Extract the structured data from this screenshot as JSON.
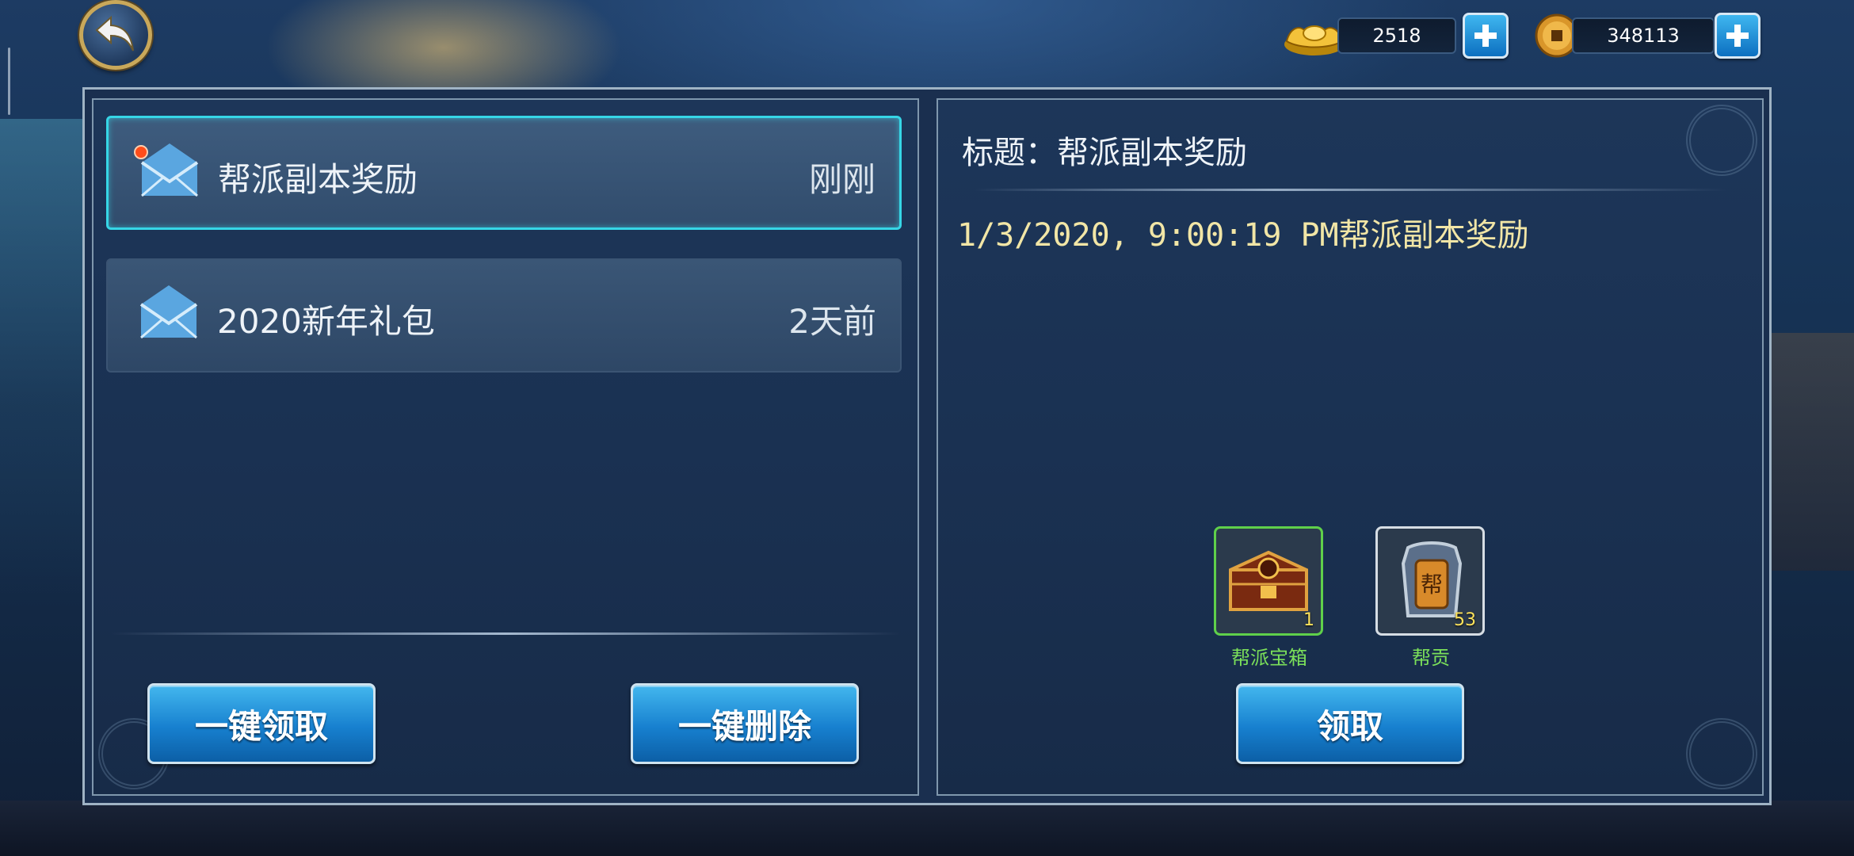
{
  "currency": {
    "gold_ingot": {
      "icon": "gold-ingot-icon",
      "value": "2518"
    },
    "copper_coin": {
      "icon": "copper-coin-icon",
      "value": "348113"
    }
  },
  "mail_list": [
    {
      "title": "帮派副本奖励",
      "time": "刚刚",
      "unread": true
    },
    {
      "title": "2020新年礼包",
      "time": "2天前",
      "unread": false
    }
  ],
  "left_buttons": {
    "claim_all": "一键领取",
    "delete_all": "一键删除"
  },
  "detail": {
    "title_line": "标题：帮派副本奖励",
    "body": "1/3/2020, 9:00:19 PM帮派副本奖励",
    "rewards": [
      {
        "name": "帮派宝箱",
        "count": "1",
        "icon": "guild-chest-icon"
      },
      {
        "name": "帮贡",
        "count": "53",
        "icon": "guild-contribution-token-icon"
      }
    ],
    "claim_button": "领取"
  },
  "colors": {
    "accent_cyan": "#36d6e6",
    "button_blue": "#1780cf",
    "reward_text": "#7be05a",
    "body_text": "#f2e6a6"
  }
}
